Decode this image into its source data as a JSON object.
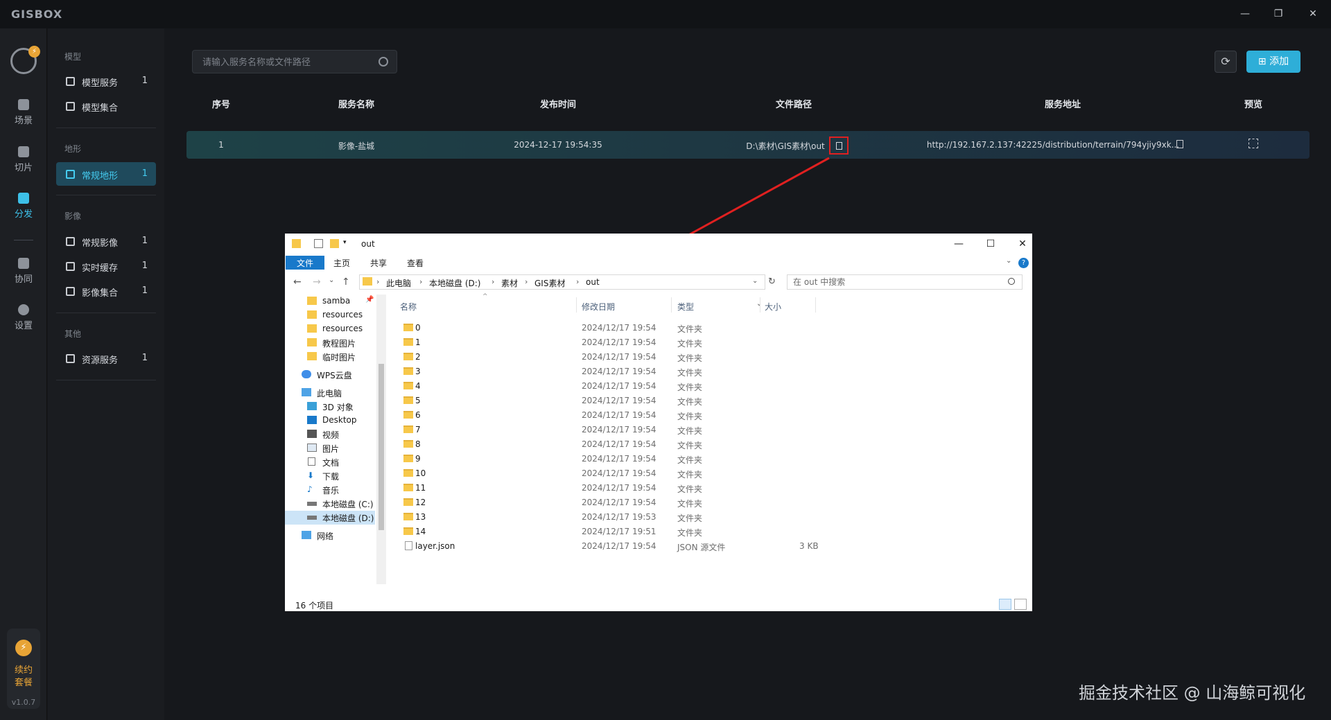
{
  "app": {
    "logo": "GISBOX",
    "version": "v1.0.7"
  },
  "window_controls": {
    "minimize": "—",
    "restore": "❐",
    "close": "✕"
  },
  "rail": {
    "avatar_badge": "⚡",
    "items": [
      {
        "label": "场景",
        "icon": "scene-icon"
      },
      {
        "label": "切片",
        "icon": "slice-icon"
      },
      {
        "label": "分发",
        "icon": "distribute-icon",
        "active": true
      },
      {
        "label": "协同",
        "icon": "collab-icon"
      },
      {
        "label": "设置",
        "icon": "settings-icon"
      }
    ],
    "renew": {
      "line1": "续约",
      "line2": "套餐",
      "icon": "⚡"
    }
  },
  "sidebar": {
    "groups": [
      {
        "title": "模型",
        "items": [
          {
            "label": "模型服务",
            "count": "1"
          },
          {
            "label": "模型集合",
            "count": ""
          }
        ]
      },
      {
        "title": "地形",
        "items": [
          {
            "label": "常规地形",
            "count": "1",
            "active": true
          }
        ]
      },
      {
        "title": "影像",
        "items": [
          {
            "label": "常规影像",
            "count": "1"
          },
          {
            "label": "实时缓存",
            "count": "1"
          },
          {
            "label": "影像集合",
            "count": "1"
          }
        ]
      },
      {
        "title": "其他",
        "items": [
          {
            "label": "资源服务",
            "count": "1"
          }
        ]
      }
    ]
  },
  "toolbar": {
    "search_placeholder": "请输入服务名称或文件路径",
    "refresh_icon": "⟳",
    "add_label": "⊞ 添加"
  },
  "table": {
    "headers": [
      "序号",
      "服务名称",
      "发布时间",
      "文件路径",
      "服务地址",
      "预览"
    ],
    "rows": [
      {
        "index": "1",
        "name": "影像-盐城",
        "time": "2024-12-17 19:54:35",
        "path": "D:\\素材\\GIS素材\\out",
        "url": "http://192.167.2.137:42225/distribution/terrain/794yjiy9xk..."
      }
    ]
  },
  "explorer": {
    "title": "out",
    "ribbon_tabs": [
      "文件",
      "主页",
      "共享",
      "查看"
    ],
    "nav": {
      "back": "←",
      "forward": "→",
      "recent": "⌄",
      "up": "↑",
      "refresh": "↻"
    },
    "breadcrumb": [
      "此电脑",
      "本地磁盘 (D:)",
      "素材",
      "GIS素材",
      "out"
    ],
    "search_placeholder": "在 out 中搜索",
    "nav_pane": [
      {
        "label": "samba",
        "type": "folder",
        "pin": true
      },
      {
        "label": "resources",
        "type": "folder"
      },
      {
        "label": "resources",
        "type": "folder"
      },
      {
        "label": "教程图片",
        "type": "folder"
      },
      {
        "label": "临时图片",
        "type": "folder"
      },
      {
        "label": "WPS云盘",
        "type": "cloud"
      },
      {
        "label": "此电脑",
        "type": "pc"
      },
      {
        "label": "3D 对象",
        "type": "3d"
      },
      {
        "label": "Desktop",
        "type": "desktop"
      },
      {
        "label": "视频",
        "type": "video"
      },
      {
        "label": "图片",
        "type": "picture"
      },
      {
        "label": "文档",
        "type": "doc"
      },
      {
        "label": "下载",
        "type": "download"
      },
      {
        "label": "音乐",
        "type": "music"
      },
      {
        "label": "本地磁盘 (C:)",
        "type": "drive"
      },
      {
        "label": "本地磁盘 (D:)",
        "type": "drive",
        "selected": true
      },
      {
        "label": "网络",
        "type": "network"
      }
    ],
    "columns": [
      "名称",
      "修改日期",
      "类型",
      "大小"
    ],
    "files": [
      {
        "name": "0",
        "date": "2024/12/17 19:54",
        "type": "文件夹",
        "size": ""
      },
      {
        "name": "1",
        "date": "2024/12/17 19:54",
        "type": "文件夹",
        "size": ""
      },
      {
        "name": "2",
        "date": "2024/12/17 19:54",
        "type": "文件夹",
        "size": ""
      },
      {
        "name": "3",
        "date": "2024/12/17 19:54",
        "type": "文件夹",
        "size": ""
      },
      {
        "name": "4",
        "date": "2024/12/17 19:54",
        "type": "文件夹",
        "size": ""
      },
      {
        "name": "5",
        "date": "2024/12/17 19:54",
        "type": "文件夹",
        "size": ""
      },
      {
        "name": "6",
        "date": "2024/12/17 19:54",
        "type": "文件夹",
        "size": ""
      },
      {
        "name": "7",
        "date": "2024/12/17 19:54",
        "type": "文件夹",
        "size": ""
      },
      {
        "name": "8",
        "date": "2024/12/17 19:54",
        "type": "文件夹",
        "size": ""
      },
      {
        "name": "9",
        "date": "2024/12/17 19:54",
        "type": "文件夹",
        "size": ""
      },
      {
        "name": "10",
        "date": "2024/12/17 19:54",
        "type": "文件夹",
        "size": ""
      },
      {
        "name": "11",
        "date": "2024/12/17 19:54",
        "type": "文件夹",
        "size": ""
      },
      {
        "name": "12",
        "date": "2024/12/17 19:54",
        "type": "文件夹",
        "size": ""
      },
      {
        "name": "13",
        "date": "2024/12/17 19:53",
        "type": "文件夹",
        "size": ""
      },
      {
        "name": "14",
        "date": "2024/12/17 19:51",
        "type": "文件夹",
        "size": ""
      },
      {
        "name": "layer.json",
        "date": "2024/12/17 19:54",
        "type": "JSON 源文件",
        "size": "3 KB",
        "is_file": true
      }
    ],
    "status": "16 个项目"
  },
  "watermark": "掘金技术社区 @ 山海鲸可视化",
  "colors": {
    "accent": "#2eaed8",
    "highlight": "#e02020",
    "bg": "#16181c"
  }
}
